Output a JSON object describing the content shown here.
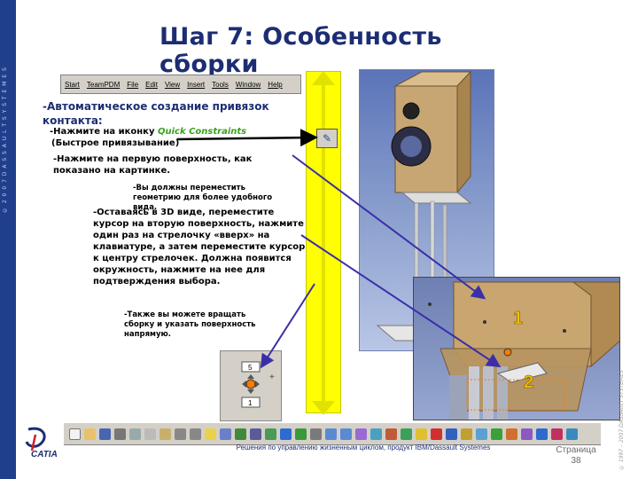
{
  "slide": {
    "title": "Шаг 7: Особенность сборки",
    "left_brand": "© 2 0 0 7   D A S S A U L T   S Y S T E M E S",
    "right_copyright": "© 1997 – 2007 DASSAULT SYSTEMES",
    "footer": "Решения по управлению жизненным циклом, продукт IBM/Dassault Systemes",
    "page_label": "Страница",
    "page_number": "38",
    "logo_text": "CATIA"
  },
  "menubar": {
    "items": [
      "Start",
      "TeamPDM",
      "File",
      "Edit",
      "View",
      "Insert",
      "Tools",
      "Window",
      "Help"
    ]
  },
  "instructions": {
    "heading": "-Автоматическое создание привязок контакта:",
    "step1_prefix": "-Нажмите на иконку ",
    "step1_link": "Quick Constraints",
    "step1_suffix": "(Быстрое привязывание)",
    "step2": "-Нажмите на первую поверхность, как показано на картинке.",
    "note1": "-Вы должны переместить геометрию для более удобного вида.",
    "step3": "-Оставаясь в 3D виде, переместите курсор на вторую поверхность, нажмите один раз на стрелочку «вверх» на клавиатуре, а затем переместите курсор к центру стрелочек. Должна появится окружность, нажмите на нее для подтверждения выбора.",
    "note2": "-Также вы можете вращать сборку и указать поверхность напрямую."
  },
  "zoom_labels": {
    "first": "1",
    "second": "2"
  },
  "mini_panel": {
    "top_value": "5",
    "bottom_value": "1",
    "plus": "+"
  },
  "colors": {
    "title": "#1c2d73",
    "highlight_bar": "#ffff00",
    "arrow": "#3a2fa8",
    "label": "#f4c200"
  }
}
